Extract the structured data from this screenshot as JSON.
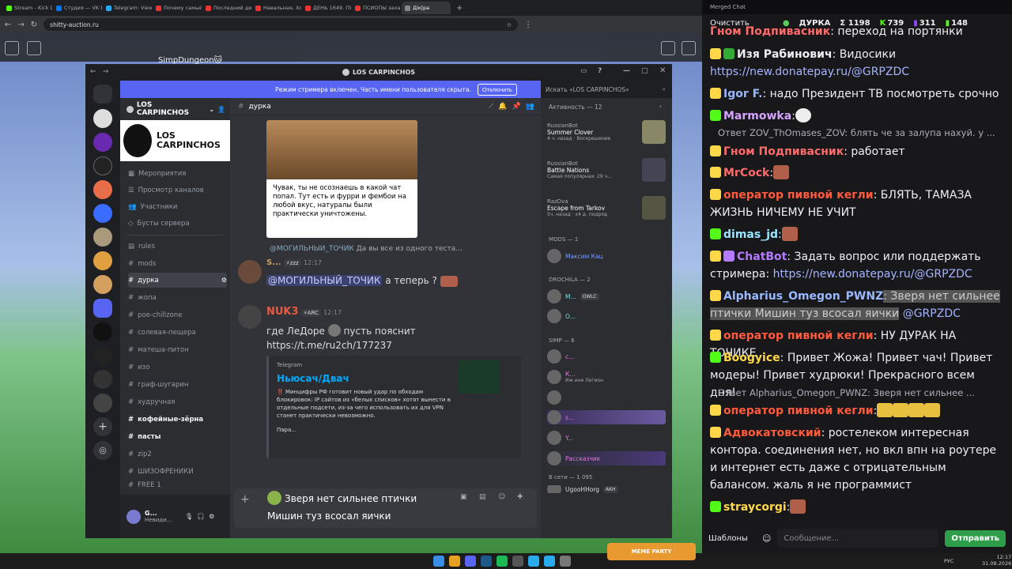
{
  "browser": {
    "tabs": [
      "Stream - Kick Dur...",
      "Студия — VK Виде...",
      "Telegram: View @...",
      "Почему самый с...",
      "Последний день...",
      "Навальная, Ходо...",
      "ДЕНЬ 1649. ПУТИ...",
      "ПСИОПЫ захаи...",
      "Дiк|ра"
    ],
    "url": "shitty-auction.ru"
  },
  "game": {
    "username": "SimpDungeon🐱"
  },
  "discord": {
    "window_title": "LOS CARPINCHOS",
    "banner_text": "Режим стримера включен. Часть имени пользователя скрыта.",
    "banner_button": "Отключить",
    "server_name": "LOS CARPINCHOS",
    "server_banner_text": "LOS CARPINCHOS",
    "menu": [
      "Мероприятия",
      "Просмотр каналов",
      "Участники",
      "Бусты сервера"
    ],
    "channels": [
      "rules",
      "mods",
      "дурка",
      "жопа",
      "poe-chillzone",
      "солевая-пещера",
      "матеша-питон",
      "изо",
      "граф-шугарин",
      "худручная",
      "кофейные-зёрна",
      "пасты",
      "zip2",
      "ШИЗОФРЕНИКИ",
      "FREE 1"
    ],
    "user_short": "G...",
    "user_status": "Невиди...",
    "current_channel": "дурка",
    "search_placeholder": "Искать «LOS CARPINCHOS»",
    "meme_text": "Чувак, ты не осознаешь в какой чат попал. Тут есть и фурри и фембои на любой вкус, натуралы были практически уничтожены.",
    "reply_preview_user": "@МОГИЛЬНЫЙ_ТОЧИК",
    "reply_preview_text": "Да вы все из одного теста...",
    "msg1_user": "S...",
    "msg1_tag": "⚡zzz",
    "msg1_time": "12:17",
    "msg1_mention": "@МОГИЛЬНЫЙ_ТОЧИК",
    "msg1_text": " а теперь ?",
    "msg2_user": "NUK3",
    "msg2_tag": "⚡ARC",
    "msg2_time": "12:17",
    "msg2_text": "где ЛеДоре",
    "msg2_text2": "пусть пояснит",
    "msg2_link": "https://t.me/ru2ch/177237",
    "embed_site": "Telegram",
    "embed_title": "Ньюсач/Двач",
    "embed_desc": "‼️ Минцифры РФ готовит новый удар по обходам блокировок: IP сайтов из «белых списков» хотят вынести в отдельные подсети, из-за чего использовать их для VPN станет практически невозможно.",
    "embed_more": "Пара...",
    "input_line1": "Зверя нет сильнее птички",
    "input_line2": "Мишин туз всосал яички",
    "activity_header": "Активность — 12",
    "activities": [
      {
        "bot": "RussianBot",
        "title": "Summer Clover",
        "sub": "4 ч. назад · Воскрешение"
      },
      {
        "bot": "RussianBot",
        "title": "Battle Nations",
        "sub": "Самая популярная: 29 ч..."
      },
      {
        "bot": "RazDva",
        "title": "Escape from Tarkov",
        "sub": "5ч. назад · x4 д. подряд"
      }
    ],
    "groups": [
      "MODS — 1",
      "DROCHILA — 2",
      "SIMP — 6",
      "В сети — 1 095"
    ],
    "members": [
      "Максим Кац",
      "М...",
      "О...",
      "с...",
      "К...",
      "Иж ине Легион",
      "s...",
      "Y...",
      "Рассказчик",
      "UgooHHorg"
    ],
    "member_tags": [
      "OWLC",
      "AKH"
    ]
  },
  "chat": {
    "window_title": "Merged Chat",
    "clear_button": "Очистить",
    "channel": "ДУРКА",
    "stats": {
      "total": "Σ 1198",
      "kick": "739",
      "twitch": "311",
      "other": "148"
    },
    "messages": [
      {
        "user": "Гном Подпивасник",
        "text": ": переход на портянки",
        "color": "#ff6b6b"
      },
      {
        "user": "Изя Рабинович",
        "text": ": Видосики",
        "color": "#ffffff"
      },
      {
        "user": "",
        "text": "https://new.donatepay.ru/@GRPZDC",
        "color": "#a6b4ff"
      },
      {
        "user": "Igor F.",
        "text": ": надо Президент ТВ посмотреть срочно",
        "color": "#9ab8ff"
      },
      {
        "user": "Marmowka",
        "text": ":",
        "color": "#d6a4ff"
      },
      {
        "user": "Ответ ZOV_ThOmases_ZOV",
        "text": ": блять че за залупа нахуй. у ...",
        "color": "#adadb8"
      },
      {
        "user": "Гном Подпивасник",
        "text": ": работает",
        "color": "#ff6b6b"
      },
      {
        "user": "MrCock",
        "text": ":",
        "color": "#ff6b6b"
      },
      {
        "user": "оператор пивной кегли",
        "text": ": БЛЯТЬ, ТАМАЗА ЖИЗНЬ НИЧЕМУ НЕ УЧИТ",
        "color": "#ff5a3c"
      },
      {
        "user": "dimas_jd",
        "text": ":",
        "color": "#9ae6ff"
      },
      {
        "user": "ChatBot",
        "text": ": Задать вопрос или поддержать стримера: ",
        "color": "#b47bff"
      },
      {
        "user": "",
        "text": "https://new.donatepay.ru/@GRPZDC",
        "color": "#a6b4ff"
      },
      {
        "user": "Alpharius_Omegon_PWNZ",
        "text": ": Зверя нет сильнее птички Мишин туз всосал яички",
        "color": "#9ab8ff"
      },
      {
        "user": "",
        "text": "@GRPZDC",
        "color": "#a6b4ff"
      },
      {
        "user": "оператор пивной кегли",
        "text": ": НУ ДУРАК НА ТОЧИКЕ",
        "color": "#ff5a3c"
      },
      {
        "user": "Boogyice",
        "text": ": Привет Жожа! Привет чач! Привет модеры! Привет худрюки! Прекрасного всем дня!",
        "color": "#ffd84a"
      },
      {
        "user": "Ответ Alpharius_Omegon_PWNZ",
        "text": ": Зверя нет сильнее ...",
        "color": "#adadb8"
      },
      {
        "user": "оператор пивной кегли",
        "text": ":",
        "color": "#ff5a3c"
      },
      {
        "user": "Адвокатовский",
        "text": ": ростелеком интересная контора. соединения нет, но вкл впн на роутере и интернет есть даже с отрицательным балансом. жаль я не программист",
        "color": "#ff5a3c"
      },
      {
        "user": "straycorgi",
        "text": ":",
        "color": "#ffd84a"
      }
    ],
    "templates_button": "Шаблоны",
    "input_placeholder": "Сообщение...",
    "send_button": "Отправить"
  },
  "taskbar": {
    "lang": "РУС",
    "time": "12:17",
    "date": "31.08.2026",
    "stream_badge": "MEME PARTY"
  }
}
